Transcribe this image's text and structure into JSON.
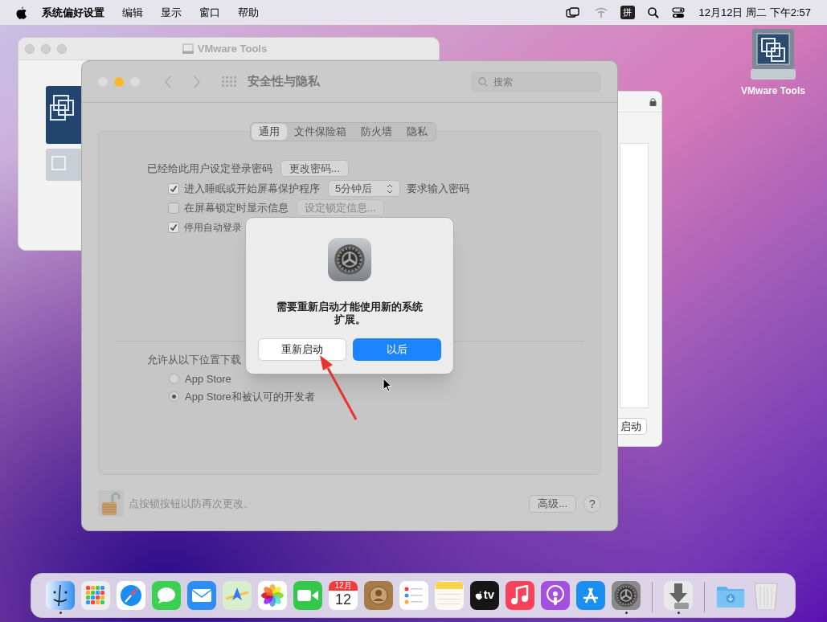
{
  "menu_bar": {
    "app_menu": "系统偏好设置",
    "items": [
      "编辑",
      "显示",
      "窗口",
      "帮助"
    ],
    "input_method": "拼",
    "clock": "12月12日 周二 下午2:57"
  },
  "desktop_icons": [
    {
      "label": "VMware Tools"
    }
  ],
  "vmware_window": {
    "title": "VMware Tools"
  },
  "background_window": {
    "button": "启动"
  },
  "prefs_window": {
    "title": "安全性与隐私",
    "search_placeholder": "搜索",
    "tabs": [
      {
        "label": "通用",
        "selected": true
      },
      {
        "label": "文件保险箱",
        "selected": false
      },
      {
        "label": "防火墙",
        "selected": false
      },
      {
        "label": "隐私",
        "selected": false
      }
    ],
    "password_label": "已经给此用户设定登录密码",
    "change_password_button": "更改密码...",
    "options": [
      {
        "label": "进入睡眠或开始屏幕保护程序",
        "checked": true,
        "popup": "5分钟后",
        "suffix": "要求输入密码"
      },
      {
        "label": "在屏幕锁定时显示信息",
        "checked": false,
        "button": "设定锁定信息...",
        "button_disabled": true
      },
      {
        "label": "停用自动登录",
        "checked": true
      }
    ],
    "allow_label": "允许从以下位置下载",
    "radios": [
      {
        "label": "App Store",
        "selected": false
      },
      {
        "label": "App Store和被认可的开发者",
        "selected": true
      }
    ],
    "lock_text": "点按锁按钮以防再次更改。",
    "advanced_button": "高级...",
    "help_button": "?"
  },
  "dialog": {
    "message": "需要重新启动才能使用新的系统扩展。",
    "buttons": [
      {
        "label": "重新启动",
        "primary": false
      },
      {
        "label": "以后",
        "primary": true
      }
    ]
  },
  "dock": [
    {
      "kind": "finder",
      "running": true
    },
    {
      "kind": "launchpad",
      "running": false
    },
    {
      "kind": "safari",
      "running": false
    },
    {
      "kind": "messages",
      "running": false
    },
    {
      "kind": "mail",
      "running": false
    },
    {
      "kind": "maps",
      "running": false
    },
    {
      "kind": "photos",
      "running": false
    },
    {
      "kind": "facetime",
      "running": false
    },
    {
      "kind": "calendar",
      "running": false,
      "month": "12月",
      "day": "12"
    },
    {
      "kind": "contacts",
      "running": false
    },
    {
      "kind": "reminders",
      "running": false
    },
    {
      "kind": "notes",
      "running": false
    },
    {
      "kind": "tv",
      "running": false,
      "label": "tv"
    },
    {
      "kind": "music",
      "running": false
    },
    {
      "kind": "podcasts",
      "running": false
    },
    {
      "kind": "appstore",
      "running": false
    },
    {
      "kind": "settings",
      "running": true
    },
    {
      "kind": "separator"
    },
    {
      "kind": "installer",
      "running": true
    },
    {
      "kind": "separator"
    },
    {
      "kind": "downloads",
      "running": false
    },
    {
      "kind": "trash",
      "running": false
    }
  ]
}
